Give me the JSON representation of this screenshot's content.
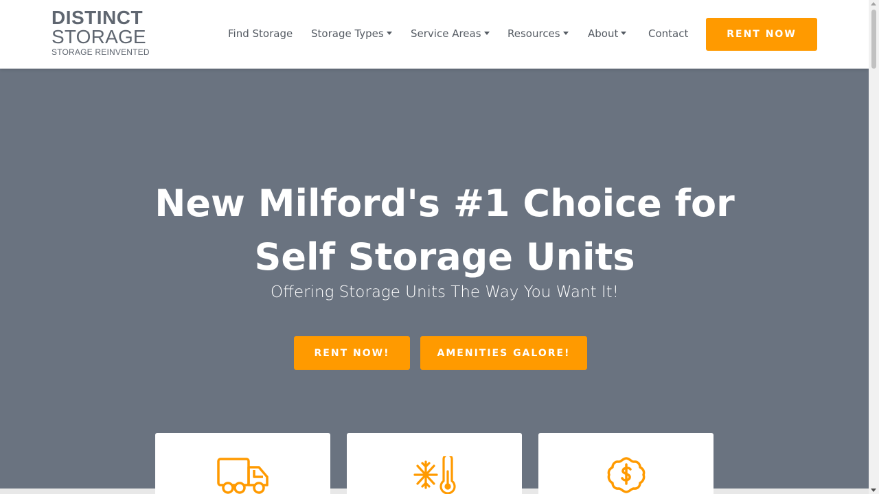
{
  "logo": {
    "line1": "DISTINCT",
    "line2": "STORAGE",
    "tagline": "STORAGE REINVENTED"
  },
  "nav": {
    "items": [
      {
        "label": "Find Storage",
        "dropdown": false
      },
      {
        "label": "Storage Types",
        "dropdown": true
      },
      {
        "label": "Service Areas",
        "dropdown": true
      },
      {
        "label": "Resources",
        "dropdown": true
      },
      {
        "label": "About",
        "dropdown": true
      },
      {
        "label": "Contact",
        "dropdown": false
      }
    ],
    "cta_label": "RENT NOW"
  },
  "hero": {
    "title": "New Milford's #1 Choice for Self Storage Units",
    "subtitle": "Offering Storage Units The Way You Want It!",
    "primary_button": "RENT NOW!",
    "secondary_button": "AMENITIES GALORE!"
  },
  "cards": [
    {
      "icon": "truck-icon"
    },
    {
      "icon": "climate-control-icon"
    },
    {
      "icon": "money-badge-icon"
    }
  ],
  "colors": {
    "accent": "#ff9a00",
    "hero_background": "#6a7380",
    "nav_text": "#555b63",
    "logo_text": "#5f6670"
  }
}
